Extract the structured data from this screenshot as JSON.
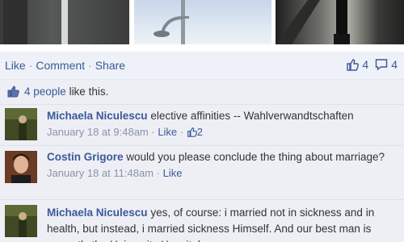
{
  "post_actions": {
    "like": "Like",
    "comment": "Comment",
    "share": "Share",
    "like_count": "4",
    "comment_count": "4"
  },
  "likes_summary": {
    "people_link": "4 people",
    "suffix": " like this."
  },
  "comments": [
    {
      "author": "Michaela Niculescu",
      "text": "elective affinities -- Wahlverwandtschaften",
      "time": "January 18 at 9:48am",
      "like_label": "Like",
      "like_count": "2"
    },
    {
      "author": "Costin Grigore",
      "text": "would you please conclude the thing about marriage?",
      "time": "January 18 at 11:48am",
      "like_label": "Like"
    },
    {
      "author": "Michaela Niculescu",
      "text": "yes, of course: i married not in sickness and in health, but instead, i married sickness Himself. And our best man is currently the University Hospital"
    }
  ],
  "icons": [
    "thumbs-up-icon",
    "comment-bubble-icon"
  ],
  "colors": {
    "link": "#3b5998",
    "meta": "#8a93a8",
    "panel": "#edeff5"
  }
}
